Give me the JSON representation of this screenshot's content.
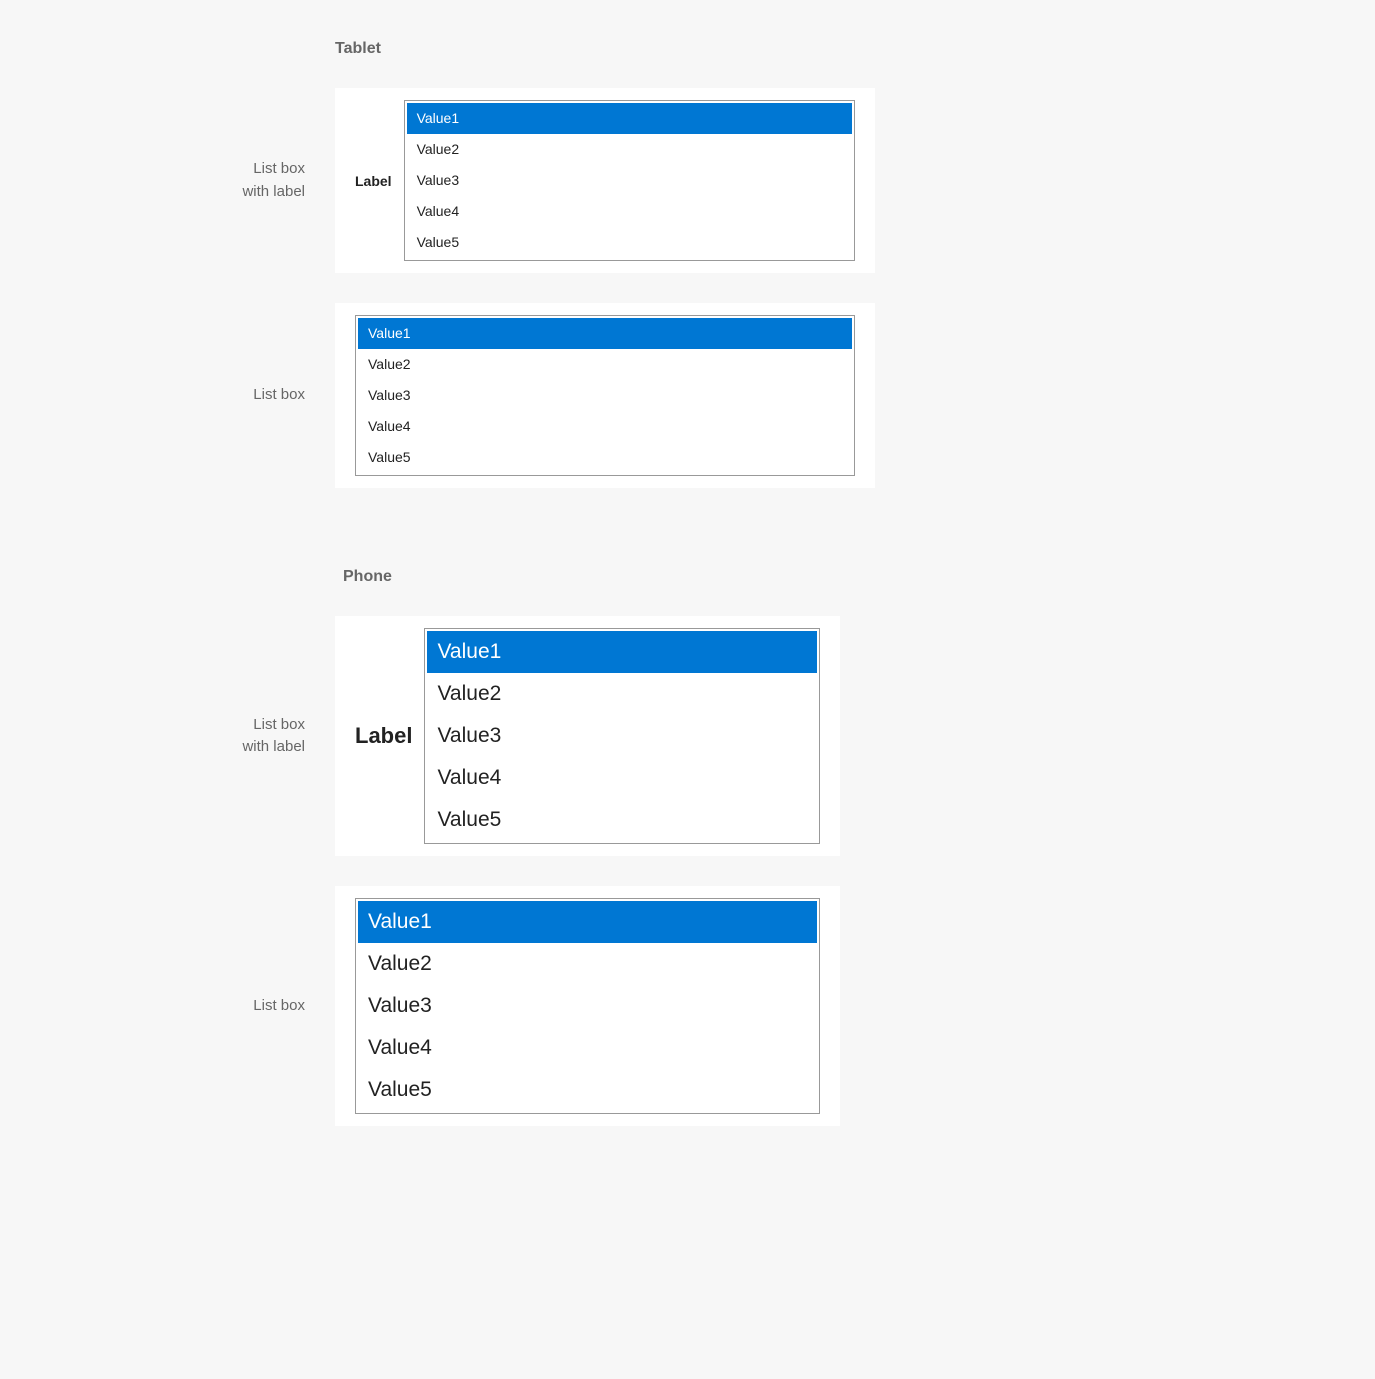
{
  "sections": {
    "tablet": {
      "heading": "Tablet"
    },
    "phone": {
      "heading": "Phone"
    }
  },
  "sideLabels": {
    "withLabel": "List box\nwith label",
    "noLabel": "List box"
  },
  "innerLabel": "Label",
  "listbox": {
    "selectedIndex": 0,
    "items": [
      "Value1",
      "Value2",
      "Value3",
      "Value4",
      "Value5"
    ]
  },
  "colors": {
    "selected": "#0077d3",
    "border": "#999999",
    "text": "#222222",
    "muted": "#666666",
    "cardBg": "#ffffff",
    "pageBg": "#f7f7f7"
  }
}
